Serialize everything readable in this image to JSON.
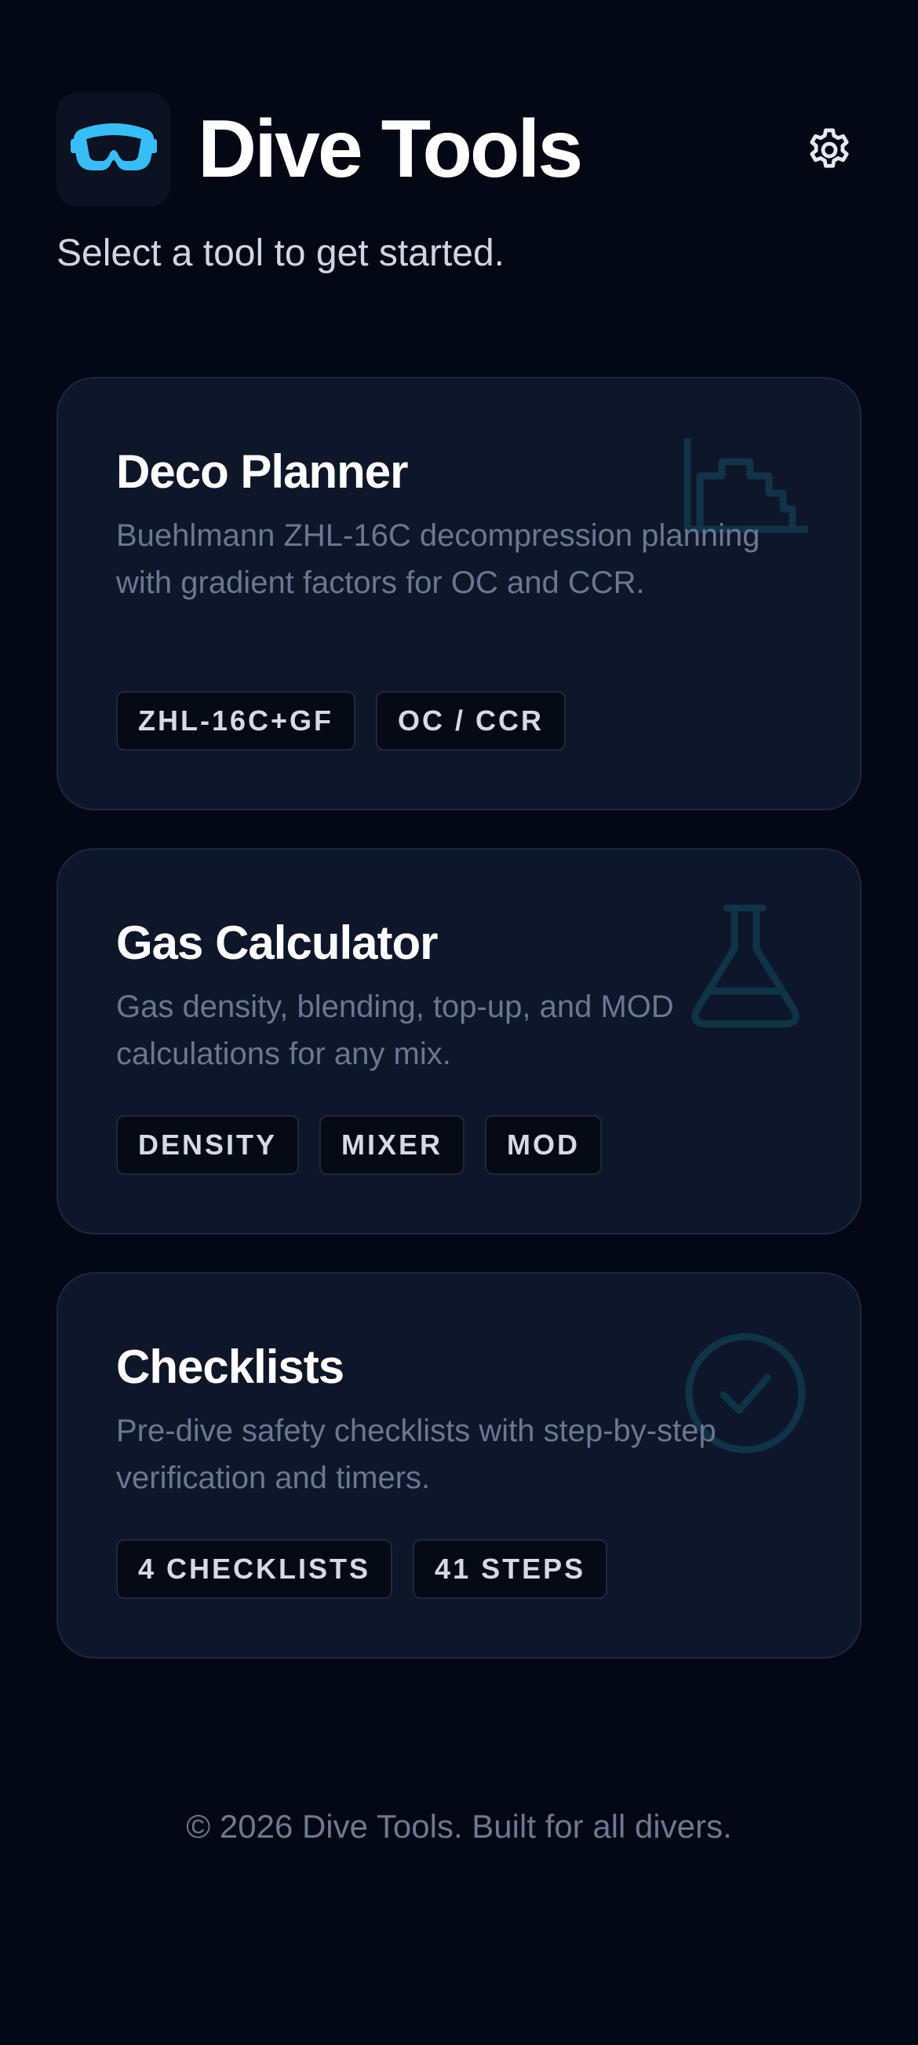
{
  "header": {
    "title": "Dive Tools",
    "subtitle": "Select a tool to get started.",
    "logo_icon": "dive-mask-icon",
    "settings_icon": "gear-icon"
  },
  "tools": [
    {
      "title": "Deco Planner",
      "description": "Buehlmann ZHL-16C decompression planning with gradient factors for OC and CCR.",
      "icon": "deco-profile-icon",
      "tags": [
        "ZHL-16C+GF",
        "OC / CCR"
      ]
    },
    {
      "title": "Gas Calculator",
      "description": "Gas density, blending, top-up, and MOD calculations for any mix.",
      "icon": "flask-icon",
      "tags": [
        "DENSITY",
        "MIXER",
        "MOD"
      ]
    },
    {
      "title": "Checklists",
      "description": "Pre-dive safety checklists with step-by-step verification and timers.",
      "icon": "check-circle-icon",
      "tags": [
        "4 CHECKLISTS",
        "41 STEPS"
      ]
    }
  ],
  "footer": {
    "text": "© 2026 Dive Tools. Built for all divers."
  },
  "colors": {
    "background": "#040814",
    "card": "#0e1629",
    "accent": "#38bdf8",
    "muted_text": "#6b7790"
  }
}
